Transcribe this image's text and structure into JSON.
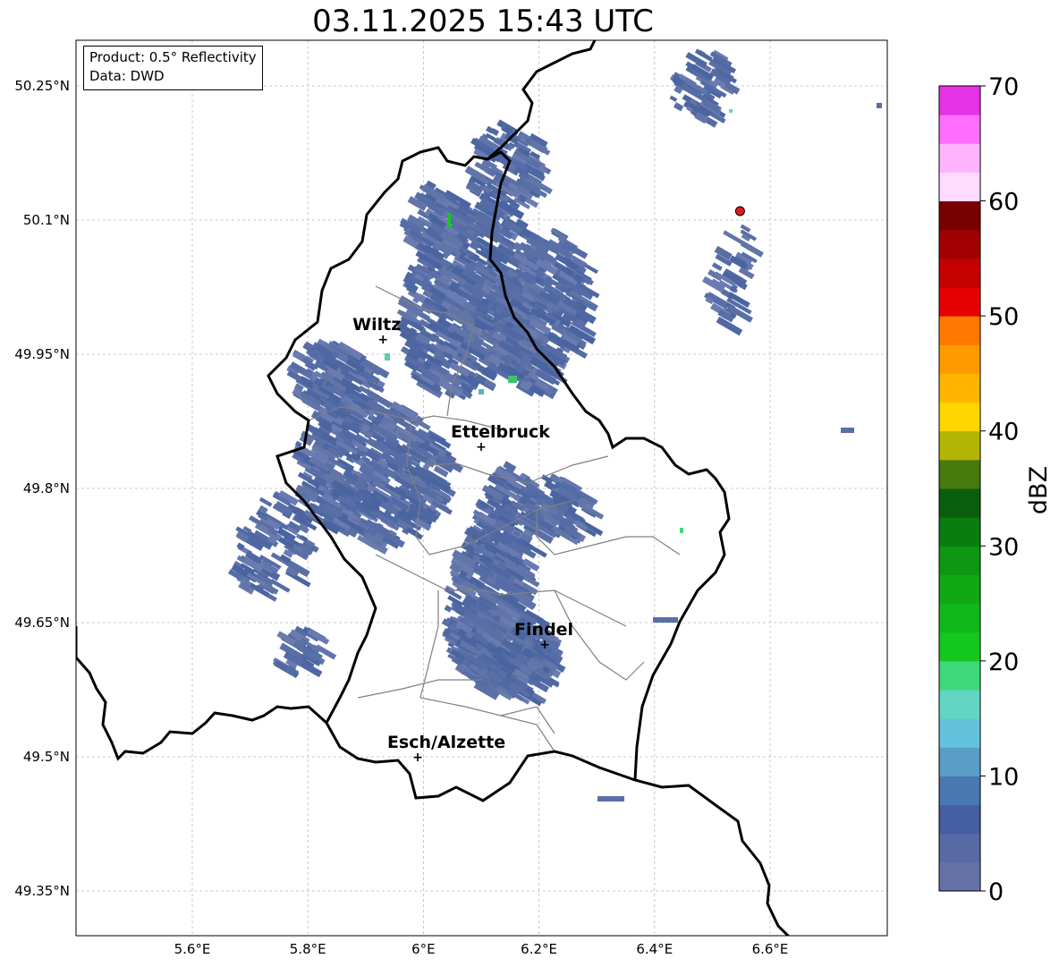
{
  "title": "03.11.2025 15:43 UTC",
  "info_box": {
    "product": "Product: 0.5° Reflectivity",
    "data": "Data: DWD"
  },
  "axes": {
    "lon_range": [
      5.4,
      6.8
    ],
    "lat_range": [
      49.3,
      50.3
    ],
    "x_ticks": [
      {
        "value": 5.6,
        "label": "5.6°E"
      },
      {
        "value": 5.8,
        "label": "5.8°E"
      },
      {
        "value": 6.0,
        "label": "6°E"
      },
      {
        "value": 6.2,
        "label": "6.2°E"
      },
      {
        "value": 6.4,
        "label": "6.4°E"
      },
      {
        "value": 6.6,
        "label": "6.6°E"
      }
    ],
    "y_ticks": [
      {
        "value": 50.25,
        "label": "50.25°N"
      },
      {
        "value": 50.1,
        "label": "50.1°N"
      },
      {
        "value": 49.95,
        "label": "49.95°N"
      },
      {
        "value": 49.8,
        "label": "49.8°N"
      },
      {
        "value": 49.65,
        "label": "49.65°N"
      },
      {
        "value": 49.5,
        "label": "49.5°N"
      },
      {
        "value": 49.35,
        "label": "49.35°N"
      }
    ],
    "grid": true
  },
  "cities": [
    {
      "name": "Wiltz",
      "lon": 5.93,
      "lat": 49.967
    },
    {
      "name": "Ettelbruck",
      "lon": 6.1,
      "lat": 49.847
    },
    {
      "name": "Findel",
      "lon": 6.21,
      "lat": 49.626
    },
    {
      "name": "Esch/Alzette",
      "lon": 5.99,
      "lat": 49.5
    }
  ],
  "radar_site": {
    "lon": 6.548,
    "lat": 50.11,
    "color": "#e41a1c"
  },
  "colorbar": {
    "label": "dBZ",
    "min": 0,
    "max": 70,
    "step": 2.5,
    "ticks": [
      0,
      10,
      20,
      30,
      40,
      50,
      60,
      70
    ],
    "colors": [
      "#6472a8",
      "#576aa4",
      "#465ea2",
      "#4a78b0",
      "#5a9ec8",
      "#64c2dc",
      "#62d6c2",
      "#3ed87a",
      "#14c81e",
      "#10b81a",
      "#10a814",
      "#0c9812",
      "#0a7c10",
      "#085e0c",
      "#467a0c",
      "#b4b404",
      "#ffd600",
      "#ffb400",
      "#ff9a00",
      "#ff7800",
      "#e60000",
      "#c40000",
      "#a00000",
      "#780000",
      "#ffdcff",
      "#ffb4ff",
      "#ff6eff",
      "#e632e6"
    ]
  },
  "reflectivity_regions": [
    {
      "area": "main band Wiltz–Ettelbruck–Findel",
      "dbz_range": [
        0,
        7.5
      ]
    },
    {
      "area": "northern cluster near 6.5°E 50.1°N",
      "dbz_range": [
        0,
        5
      ]
    },
    {
      "area": "isolated cells near 5.95°E 49.94°N and 6.15°E 49.93°N",
      "dbz_range": [
        15,
        22.5
      ]
    }
  ]
}
